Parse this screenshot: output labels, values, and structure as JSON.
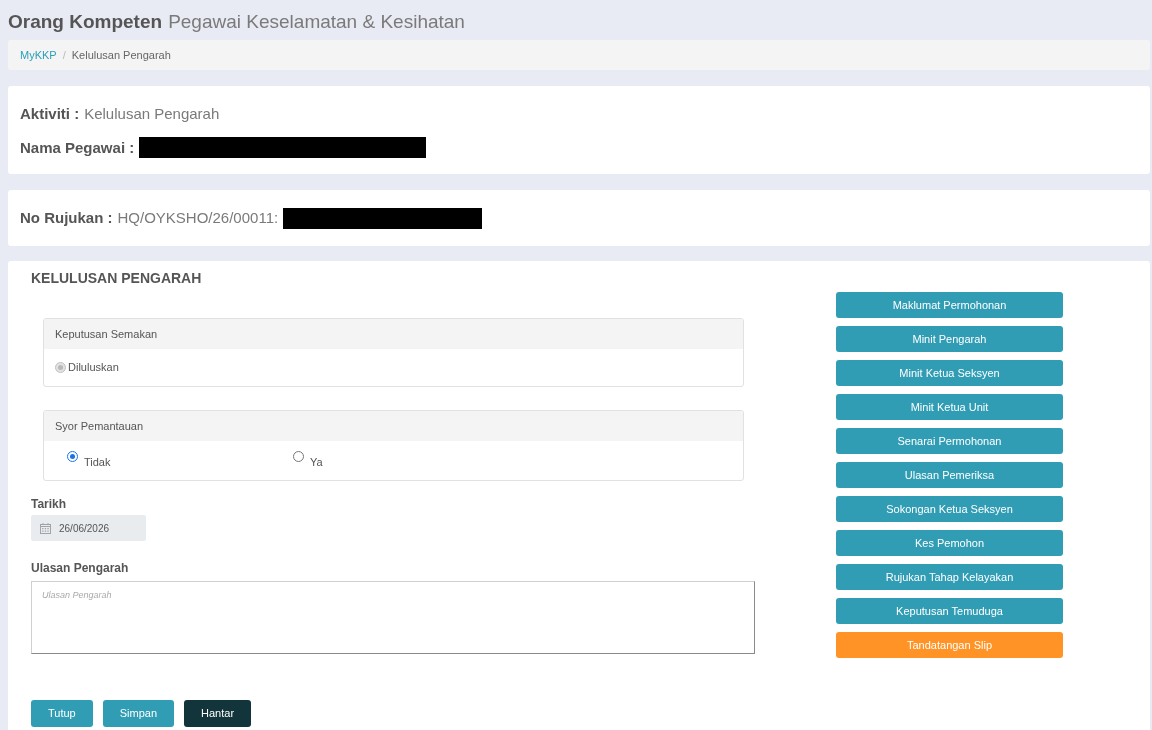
{
  "header": {
    "title": "Orang Kompeten",
    "subtitle": "Pegawai Keselamatan & Kesihatan"
  },
  "breadcrumb": {
    "separator": "/",
    "items": [
      {
        "label": "MyKKP",
        "kind": "link"
      },
      {
        "label": "Kelulusan Pengarah",
        "kind": "current"
      }
    ]
  },
  "info_card": {
    "fields": [
      {
        "label": "Aktiviti :",
        "value": "Kelulusan Pengarah"
      },
      {
        "label": "Nama Pegawai :",
        "redacted": true
      }
    ]
  },
  "reference_card": {
    "label": "No Rujukan :",
    "value": "HQ/OYKSHO/26/00011:",
    "redacted": true
  },
  "form": {
    "title": "KELULUSAN PENGARAH",
    "panels": [
      {
        "heading": "Keputusan Semakan",
        "kind": "plain",
        "options": [
          {
            "label": "Diluluskan",
            "selected": true,
            "disabled": true
          }
        ]
      },
      {
        "heading": "Syor Pemantauan",
        "kind": "columns",
        "options": [
          {
            "label": "Tidak",
            "selected": true,
            "disabled": false
          },
          {
            "label": "Ya",
            "selected": false,
            "disabled": false
          }
        ]
      }
    ],
    "date": {
      "label": "Tarikh",
      "value": "26/06/2026"
    },
    "comment": {
      "label": "Ulasan Pengarah",
      "placeholder": "Ulasan Pengarah"
    },
    "actions": [
      {
        "label": "Tutup",
        "kind": "info"
      },
      {
        "label": "Simpan",
        "kind": "info"
      },
      {
        "label": "Hantar",
        "kind": "dark"
      }
    ]
  },
  "side_buttons": [
    {
      "label": "Maklumat Permohonan",
      "kind": "info"
    },
    {
      "label": "Minit Pengarah",
      "kind": "info"
    },
    {
      "label": "Minit Ketua Seksyen",
      "kind": "info"
    },
    {
      "label": "Minit Ketua Unit",
      "kind": "info"
    },
    {
      "label": "Senarai Permohonan",
      "kind": "info"
    },
    {
      "label": "Ulasan Pemeriksa",
      "kind": "info"
    },
    {
      "label": "Sokongan Ketua Seksyen",
      "kind": "info"
    },
    {
      "label": "Kes Pemohon",
      "kind": "info"
    },
    {
      "label": "Rujukan Tahap Kelayakan",
      "kind": "info"
    },
    {
      "label": "Keputusan Temuduga",
      "kind": "info"
    },
    {
      "label": "Tandatangan Slip",
      "kind": "warning"
    }
  ]
}
